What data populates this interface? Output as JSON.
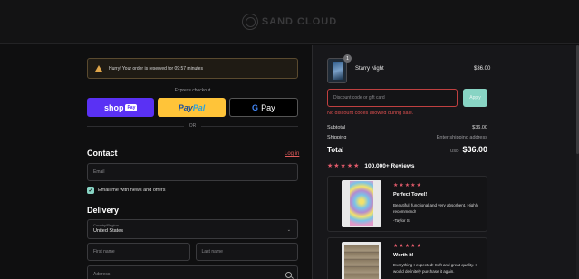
{
  "header": {
    "brand": "SAND CLOUD"
  },
  "timer": {
    "text": "Hurry! Your order is reserved for 09:57 minutes"
  },
  "express": {
    "label": "Express checkout",
    "shop": "shop",
    "shop_badge": "Pay",
    "paypal_a": "Pay",
    "paypal_b": "Pal",
    "gpay_g": "G",
    "gpay": "Pay",
    "or": "OR"
  },
  "contact": {
    "heading": "Contact",
    "login": "Log in",
    "email_placeholder": "Email",
    "news_label": "Email me with news and offers",
    "news_checked": true
  },
  "delivery": {
    "heading": "Delivery",
    "country_label": "Country/Region",
    "country_value": "United States",
    "first_name": "First name",
    "last_name": "Last name",
    "address": "Address"
  },
  "cart": {
    "quantity": "1",
    "product_name": "Starry Night",
    "product_price": "$36.00"
  },
  "discount": {
    "placeholder": "Discount code or gift card",
    "apply": "Apply",
    "error": "No discount codes allowed during sale."
  },
  "summary": {
    "subtotal_label": "Subtotal",
    "subtotal_value": "$36.00",
    "shipping_label": "Shipping",
    "shipping_value": "Enter shipping address",
    "total_label": "Total",
    "currency": "USD",
    "total_value": "$36.00"
  },
  "reviews": {
    "stars": "★★★★★",
    "count": "100,000+ Reviews",
    "items": [
      {
        "stars": "★★★★★",
        "title": "Perfect Towel!",
        "body": "Beautiful, functional and very absorbent. Highly recommend!",
        "author": "-Taylor S."
      },
      {
        "stars": "★★★★★",
        "title": "Worth it!",
        "body": "Everything I expected! Soft and great quality. I would definitely purchase it again.",
        "author": ""
      }
    ]
  },
  "colors": {
    "accent": "#e05a6a",
    "apply_button": "#88d4c4",
    "error": "#e05050",
    "shop_pay": "#5a31f4",
    "paypal": "#ffc439"
  }
}
